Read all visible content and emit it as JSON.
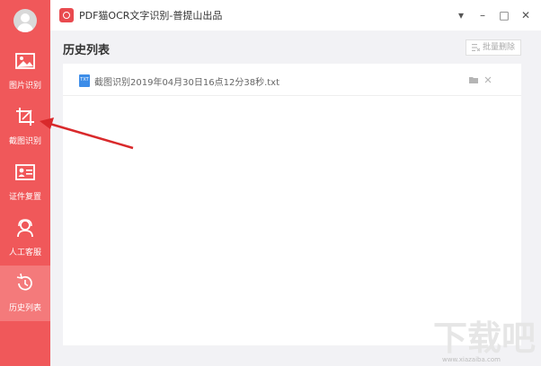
{
  "window": {
    "title": "PDF猫OCR文字识别-普提山出品",
    "controls": {
      "dropdown": "▾",
      "minimize": "–",
      "maximize": "□",
      "close": "✕"
    }
  },
  "sidebar": {
    "items": [
      {
        "label": "图片识别",
        "icon": "image-icon",
        "active": false
      },
      {
        "label": "截图识别",
        "icon": "crop-icon",
        "active": false
      },
      {
        "label": "证件复置",
        "icon": "id-card-icon",
        "active": false
      },
      {
        "label": "人工客服",
        "icon": "headset-icon",
        "active": false
      },
      {
        "label": "历史列表",
        "icon": "history-icon",
        "active": true
      }
    ]
  },
  "main": {
    "title": "历史列表",
    "batch_delete_label": "批量删除",
    "files": [
      {
        "type": "TXT",
        "name": "截图识别2019年04月30日16点12分38秒.txt"
      }
    ]
  },
  "colors": {
    "sidebar": "#f0585a",
    "sidebar_active": "#f47a7b",
    "accent": "#e94a4f",
    "file_icon": "#3d8de8",
    "content_bg": "#f2f2f5"
  },
  "watermark": {
    "text": "下载吧",
    "url_text": "www.xiazaiba.com"
  }
}
